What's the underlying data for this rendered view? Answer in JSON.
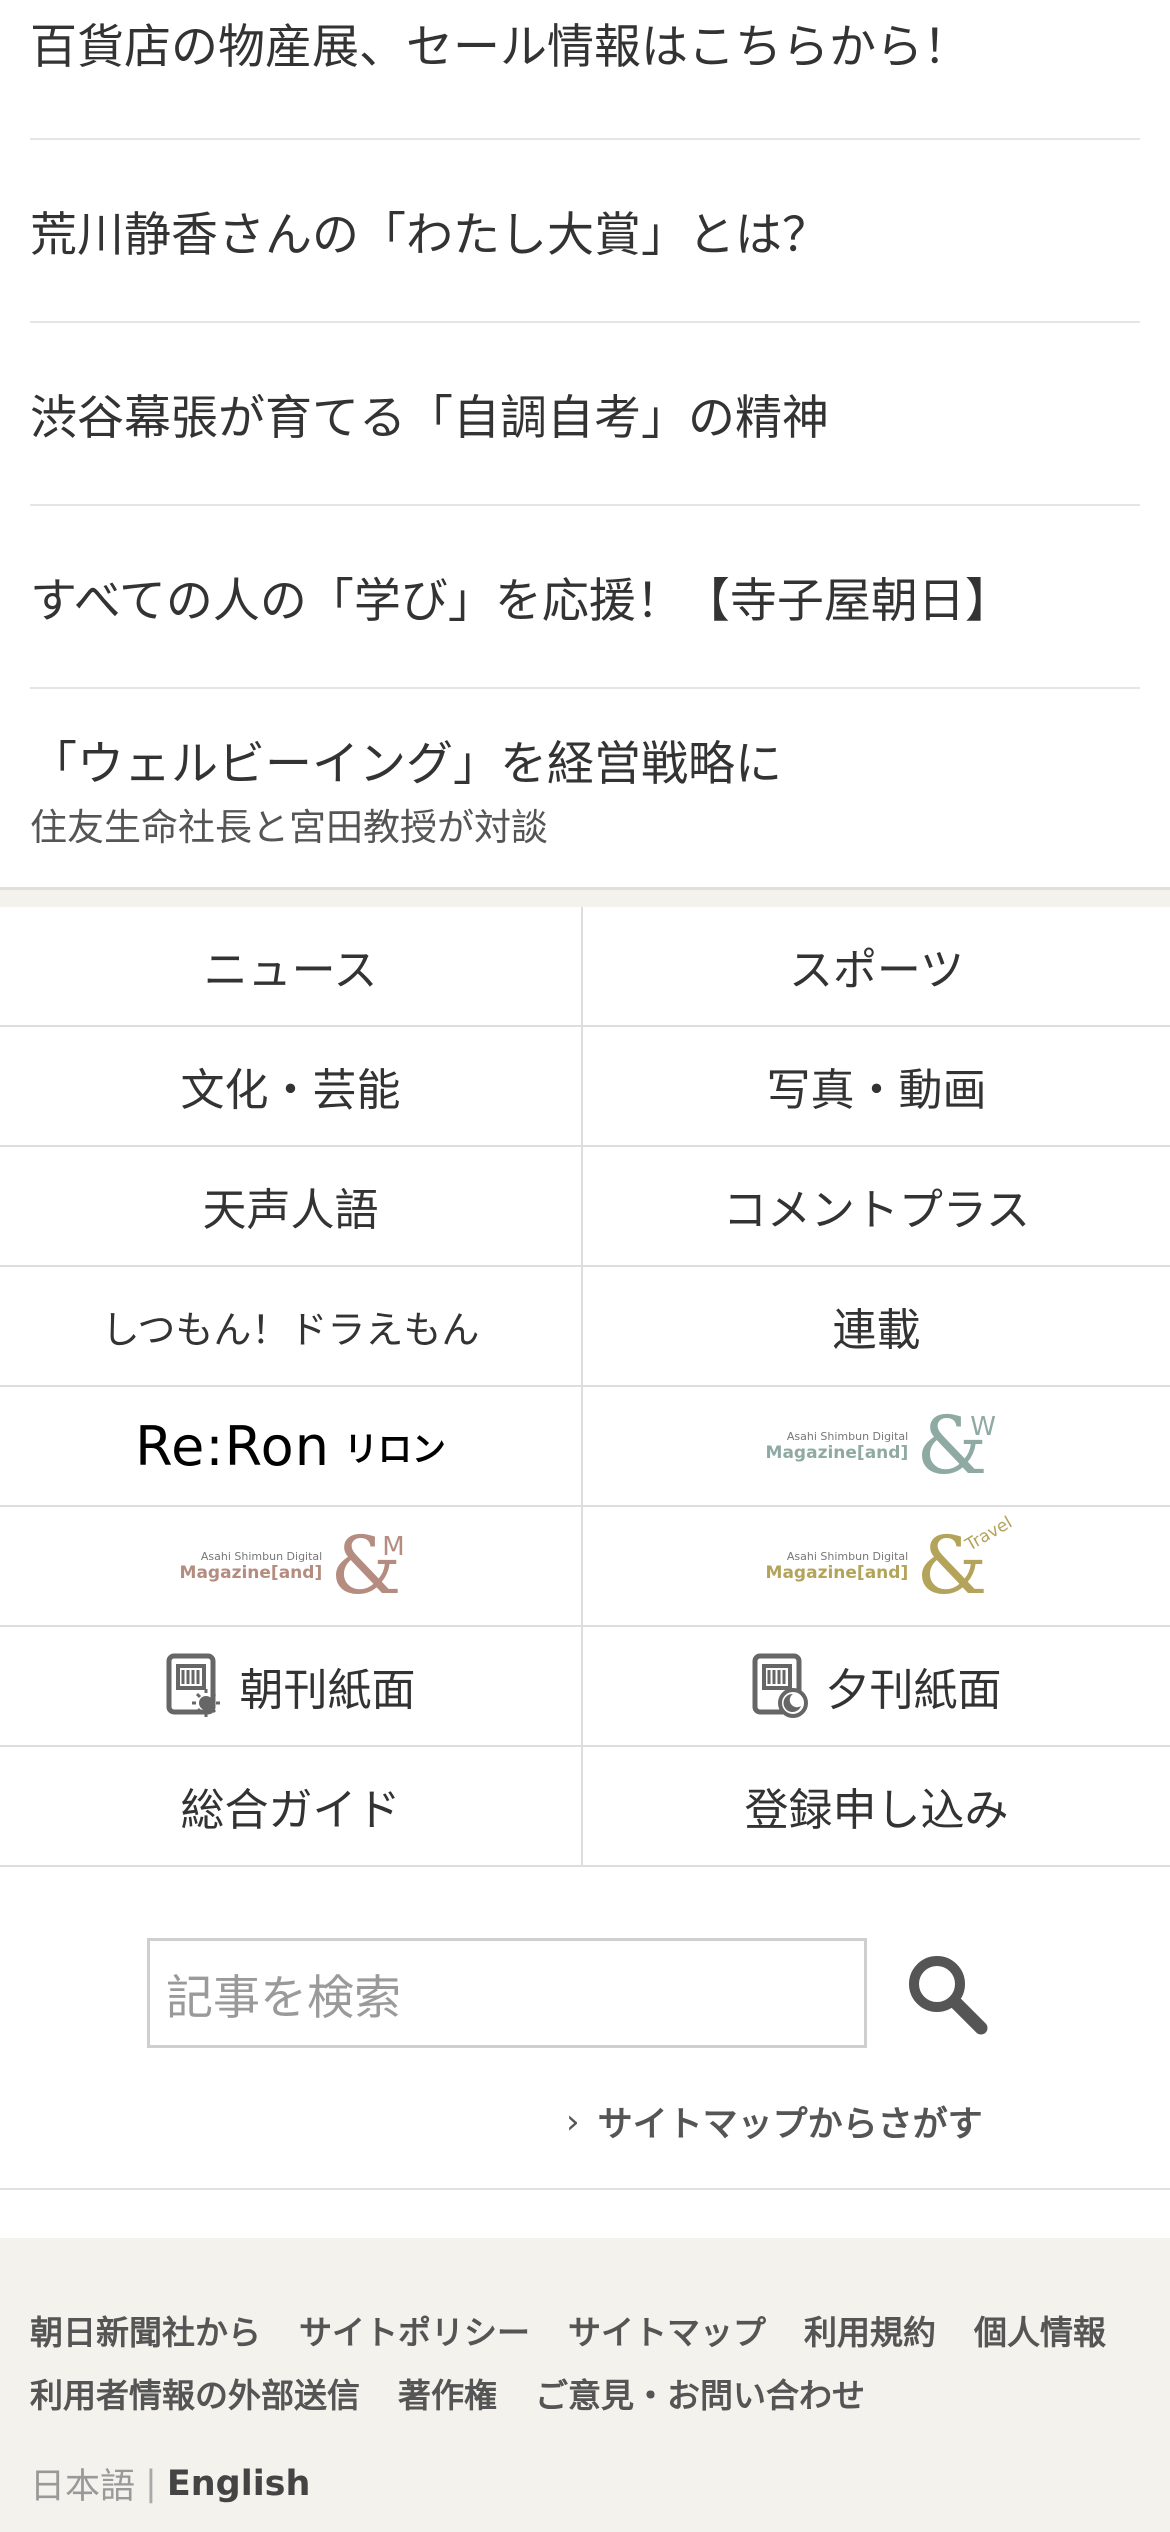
{
  "articles": [
    {
      "title": "百貨店の物産展、セール情報はこちらから！"
    },
    {
      "title": "荒川静香さんの「わたし大賞」とは？"
    },
    {
      "title": "渋谷幕張が育てる「自調自考」の精神"
    },
    {
      "title": "すべての人の「学び」を応援！【寺子屋朝日】"
    },
    {
      "title": "「ウェルビーイング」を経営戦略に",
      "subtitle": "住友生命社長と宮田教授が対談"
    }
  ],
  "nav_grid": {
    "news": "ニュース",
    "sports": "スポーツ",
    "culture": "文化・芸能",
    "photo_video": "写真・動画",
    "tensei_jingo": "天声人語",
    "comment_plus": "コメントプラス",
    "shitsumon": "しつもん！ドラえもん",
    "rensai": "連載",
    "reron_logo": "Re:Ron",
    "reron_ja": "リロン",
    "mag_line1": "Asahi Shimbun Digital",
    "mag_line2": "Magazine[and]",
    "and_w_sub": "W",
    "and_m_sub": "M",
    "and_travel_sub": "Travel",
    "morning_paper": "朝刊紙面",
    "evening_paper": "夕刊紙面",
    "guide": "総合ガイド",
    "signup": "登録申し込み"
  },
  "colors": {
    "and_w": "#8fa9a3",
    "and_m": "#b58c80",
    "and_travel": "#b4a35a"
  },
  "search": {
    "placeholder": "記事を検索",
    "sitemap_link": "サイトマップからさがす"
  },
  "footer": {
    "links_row1": [
      "朝日新聞社から",
      "サイトポリシー",
      "サイトマップ",
      "利用規約",
      "個人情報"
    ],
    "links_row2": [
      "利用者情報の外部送信",
      "著作権",
      "ご意見・お問い合わせ"
    ],
    "lang_ja": "日本語",
    "lang_separator": "|",
    "lang_en": "English"
  }
}
